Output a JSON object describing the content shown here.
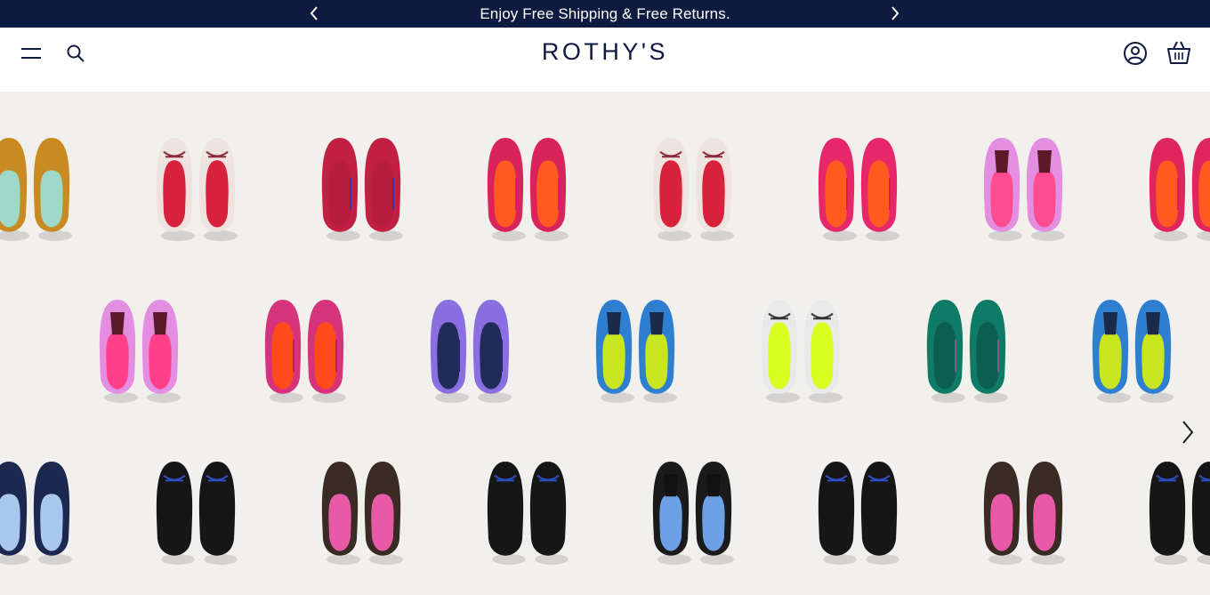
{
  "promo": {
    "text": "Enjoy Free Shipping & Free Returns.",
    "prev_icon": "chevron-left-icon",
    "next_icon": "chevron-right-icon"
  },
  "header": {
    "logo": "ROTHY'S",
    "menu_icon": "hamburger-menu-icon",
    "search_icon": "search-icon",
    "account_icon": "account-icon",
    "cart_icon": "shopping-bag-icon"
  },
  "hero": {
    "next_icon": "chevron-right-icon",
    "shoe_rows": [
      [
        {
          "style": "loafer",
          "upper": "#c98a22",
          "sole": "#9fd9c8"
        },
        {
          "style": "bow",
          "upper": "#efe3e0",
          "sole": "#d8213a",
          "trim": "#8a2a3a"
        },
        {
          "style": "flat",
          "upper": "#c21f44",
          "sole": "#b81c3e",
          "trim": "#2d3fa8"
        },
        {
          "style": "point",
          "upper": "#d8245a",
          "sole": "#ff5a1f",
          "trim": "#e0186e"
        },
        {
          "style": "bow",
          "upper": "#efe3e0",
          "sole": "#d8213a",
          "trim": "#8a2a3a"
        },
        {
          "style": "point",
          "upper": "#e8266a",
          "sole": "#ff5a1f",
          "trim": "#d81e5a"
        },
        {
          "style": "tassel",
          "upper": "#e38ee0",
          "sole": "#ff4d8f",
          "trim": "#5a1a2a"
        },
        {
          "style": "point",
          "upper": "#e1265e",
          "sole": "#ff5a1f",
          "trim": "#d81e5a"
        }
      ],
      [
        {
          "style": "tassel",
          "upper": "#e38ee0",
          "sole": "#ff3f8a",
          "trim": "#5a1a2a"
        },
        {
          "style": "flat",
          "upper": "#d6347a",
          "sole": "#ff4a1a",
          "trim": "#b51f5c"
        },
        {
          "style": "flat",
          "upper": "#8b6ee0",
          "sole": "#1f2b5a",
          "trim": "#2a2a70"
        },
        {
          "style": "tassel",
          "upper": "#2f7fd0",
          "sole": "#c9e61f",
          "trim": "#1a2a4a"
        },
        {
          "style": "bow",
          "upper": "#e9e9e9",
          "sole": "#d8ff1f",
          "trim": "#333333"
        },
        {
          "style": "point",
          "upper": "#0f7a66",
          "sole": "#0c5e50",
          "trim": "#8a5a8a"
        },
        {
          "style": "tassel",
          "upper": "#2f7fd0",
          "sole": "#c9e61f",
          "trim": "#1a2a4a"
        }
      ],
      [
        {
          "style": "loafer",
          "upper": "#1c2850",
          "sole": "#a8c8ee"
        },
        {
          "style": "bow",
          "upper": "#161616",
          "sole": "#161616",
          "trim": "#2c50c0"
        },
        {
          "style": "loafer",
          "upper": "#3a2a24",
          "sole": "#e85aa8"
        },
        {
          "style": "bow",
          "upper": "#161616",
          "sole": "#161616",
          "trim": "#2c50c0"
        },
        {
          "style": "tassel",
          "upper": "#1a1a1a",
          "sole": "#6ea0e6",
          "trim": "#111111"
        },
        {
          "style": "bow",
          "upper": "#161616",
          "sole": "#161616",
          "trim": "#2c50c0"
        },
        {
          "style": "loafer",
          "upper": "#3a2a24",
          "sole": "#e85aa8"
        },
        {
          "style": "bow",
          "upper": "#161616",
          "sole": "#161616",
          "trim": "#2c50c0"
        }
      ]
    ]
  }
}
